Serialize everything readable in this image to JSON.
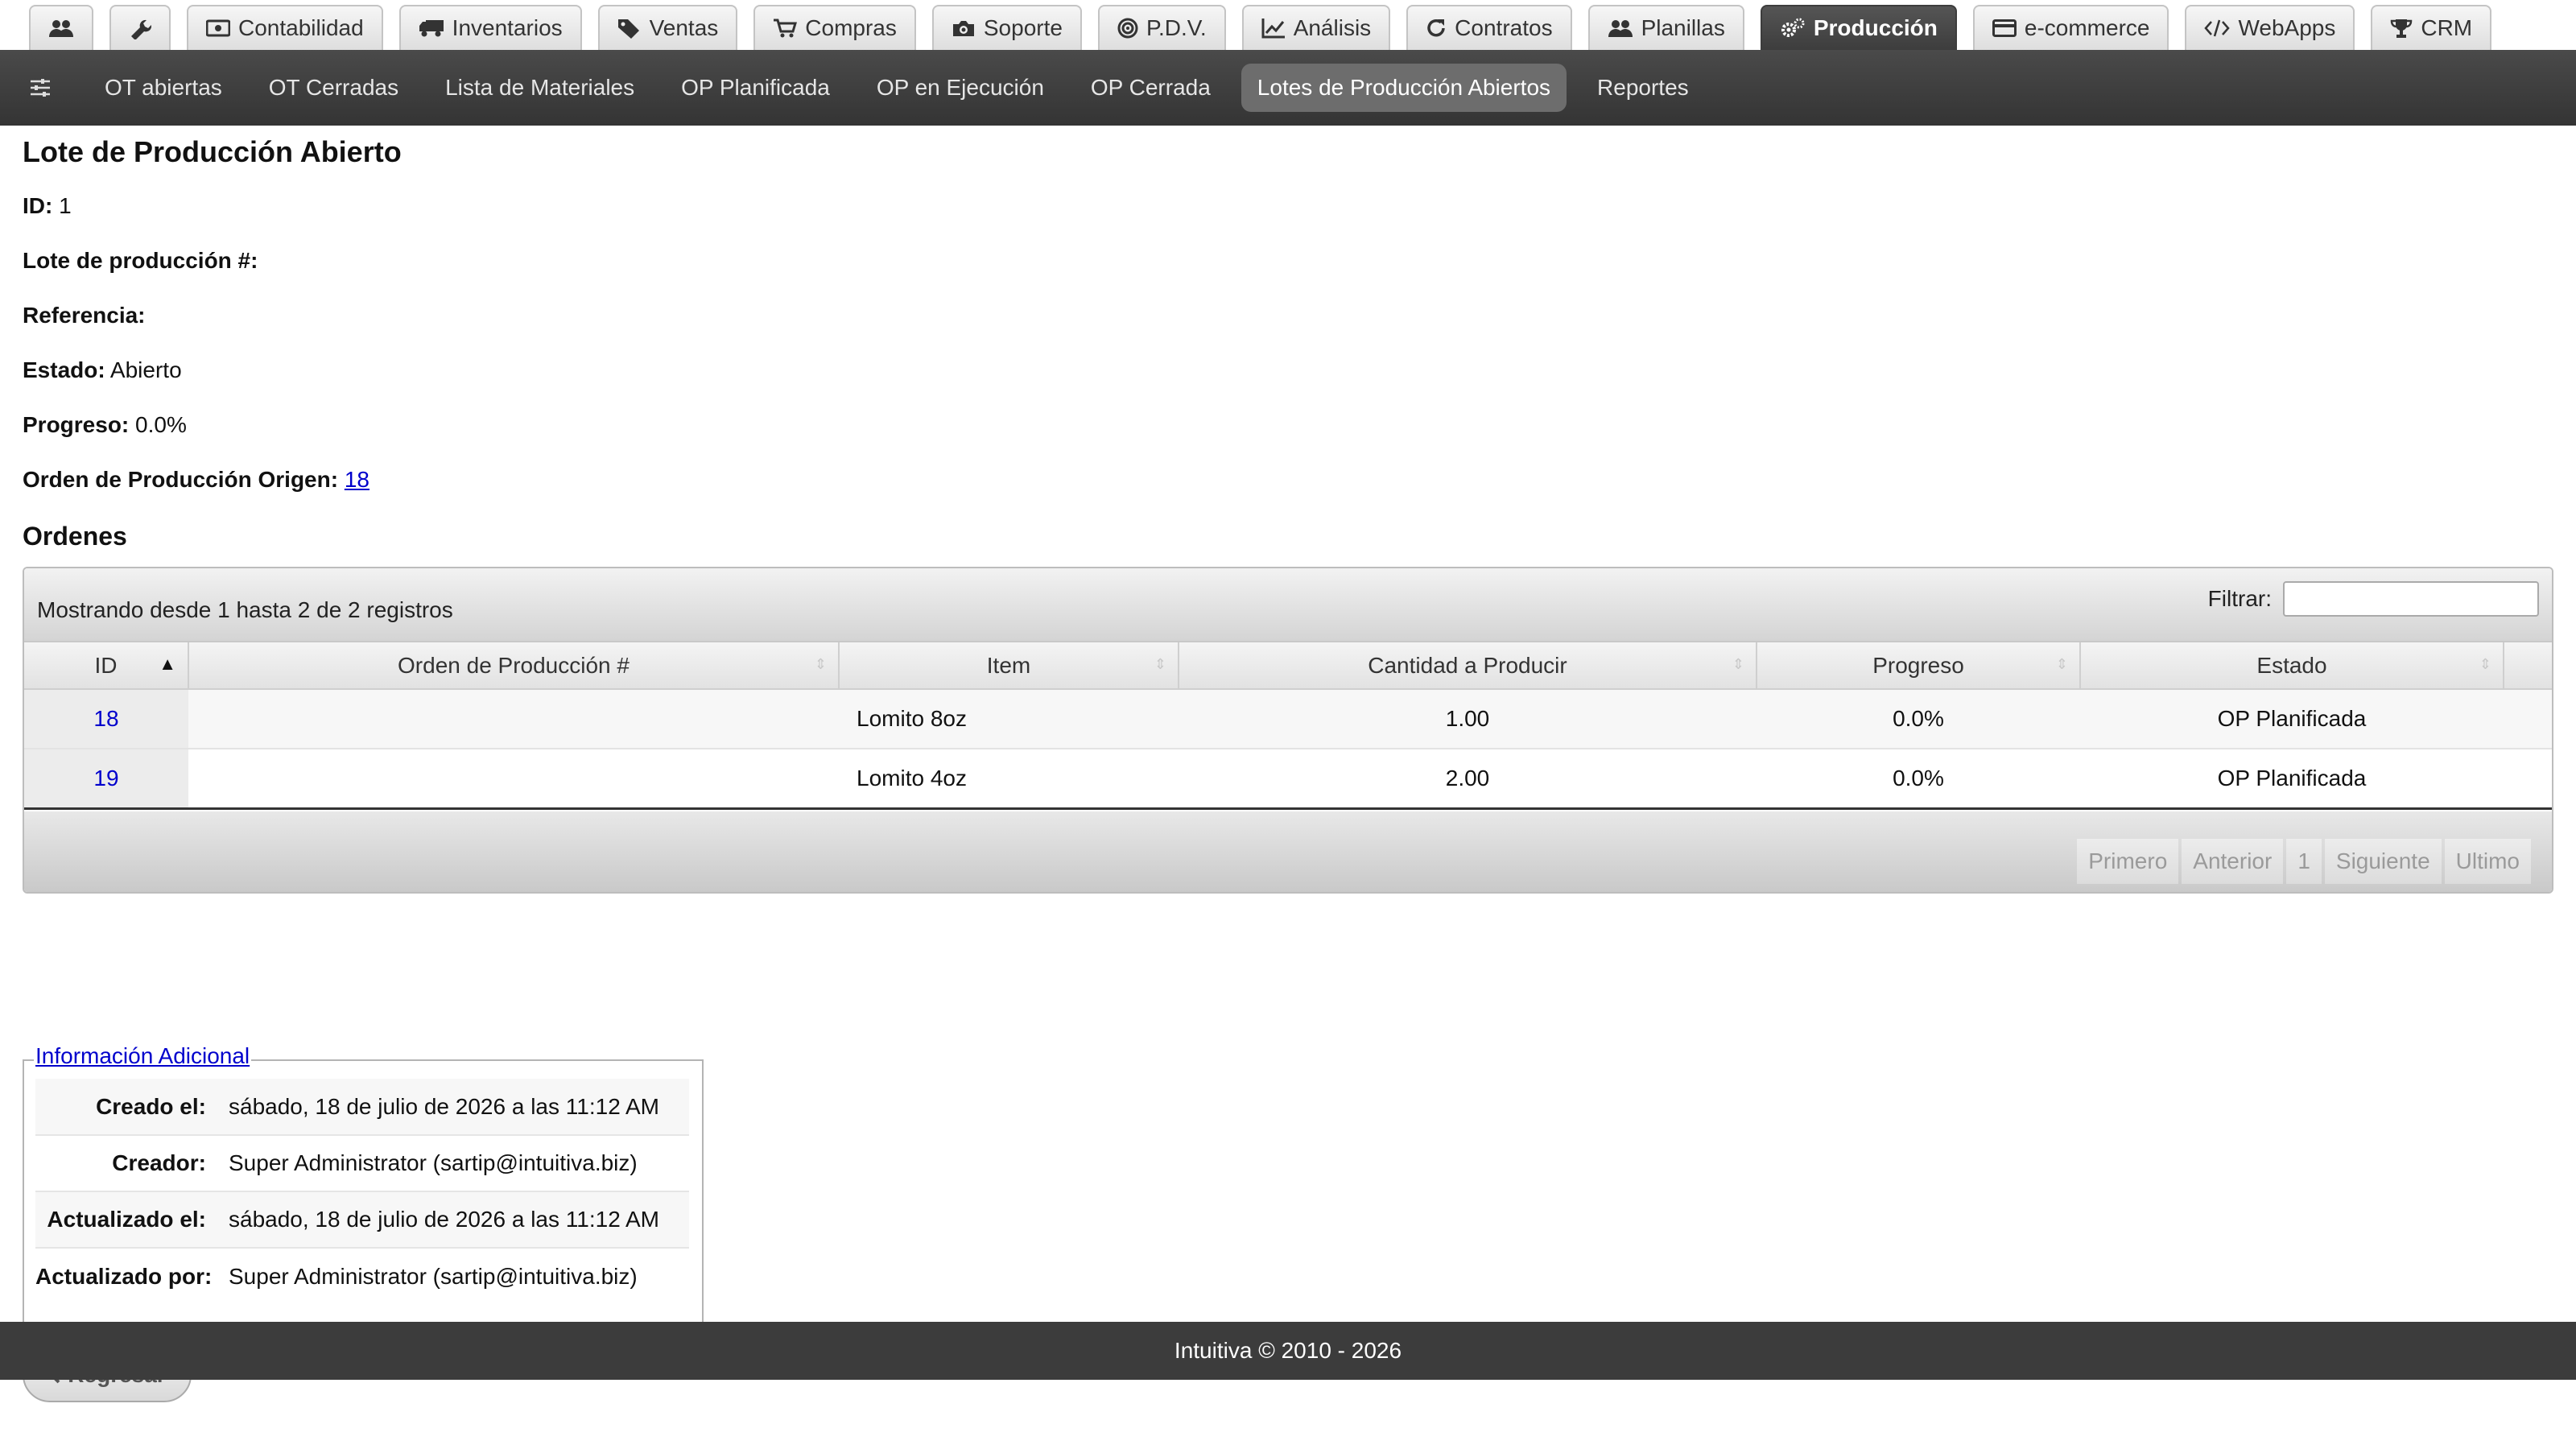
{
  "top_tabs": [
    {
      "label": "",
      "icon": "users-icon"
    },
    {
      "label": "",
      "icon": "wrench-icon"
    },
    {
      "label": "Contabilidad",
      "icon": "money-icon"
    },
    {
      "label": "Inventarios",
      "icon": "truck-icon"
    },
    {
      "label": "Ventas",
      "icon": "tag-icon"
    },
    {
      "label": "Compras",
      "icon": "cart-icon"
    },
    {
      "label": "Soporte",
      "icon": "camera-icon"
    },
    {
      "label": "P.D.V.",
      "icon": "target-icon"
    },
    {
      "label": "Análisis",
      "icon": "chart-icon"
    },
    {
      "label": "Contratos",
      "icon": "refresh-icon"
    },
    {
      "label": "Planillas",
      "icon": "users-icon"
    },
    {
      "label": "Producción",
      "icon": "gears-icon",
      "active": true
    },
    {
      "label": "e-commerce",
      "icon": "credit-card-icon"
    },
    {
      "label": "WebApps",
      "icon": "code-icon"
    },
    {
      "label": "CRM",
      "icon": "trophy-icon"
    }
  ],
  "subnav": {
    "items": [
      "OT abiertas",
      "OT Cerradas",
      "Lista de Materiales",
      "OP Planificada",
      "OP en Ejecución",
      "OP Cerrada",
      "Lotes de Producción Abiertos",
      "Reportes"
    ],
    "active_index": 6
  },
  "page": {
    "title": "Lote de Producción Abierto",
    "fields": {
      "id_label": "ID:",
      "id_value": "1",
      "lote_label": "Lote de producción #:",
      "lote_value": "",
      "ref_label": "Referencia:",
      "ref_value": "",
      "estado_label": "Estado:",
      "estado_value": "Abierto",
      "progreso_label": "Progreso:",
      "progreso_value": "0.0%",
      "origen_label": "Orden de Producción Origen:",
      "origen_value": "18"
    },
    "ordenes_title": "Ordenes"
  },
  "table": {
    "info": "Mostrando desde 1 hasta 2 de 2 registros",
    "filter_label": "Filtrar:",
    "filter_value": "",
    "columns": [
      "ID",
      "Orden de Producción #",
      "Item",
      "Cantidad a Producir",
      "Progreso",
      "Estado"
    ],
    "rows": [
      {
        "id": "18",
        "orden": "",
        "item": "Lomito 8oz",
        "cantidad": "1.00",
        "progreso": "0.0%",
        "estado": "OP Planificada"
      },
      {
        "id": "19",
        "orden": "",
        "item": "Lomito 4oz",
        "cantidad": "2.00",
        "progreso": "0.0%",
        "estado": "OP Planificada"
      }
    ],
    "pager": {
      "first": "Primero",
      "prev": "Anterior",
      "page": "1",
      "next": "Siguiente",
      "last": "Ultimo"
    }
  },
  "extra": {
    "legend": "Información Adicional",
    "rows": [
      {
        "k": "Creado el:",
        "v": "sábado, 18 de julio de 2026 a las 11:12 AM"
      },
      {
        "k": "Creador:",
        "v": "Super Administrator (sartip@intuitiva.biz)"
      },
      {
        "k": "Actualizado el:",
        "v": "sábado, 18 de julio de 2026 a las 11:12 AM"
      },
      {
        "k": "Actualizado por:",
        "v": "Super Administrator (sartip@intuitiva.biz)"
      }
    ]
  },
  "back_label": "Regresar",
  "footer": "Intuitiva © 2010 - 2026",
  "colors": {
    "active_tab": "#3d3d3d",
    "subnav_bg": "#3a3a3a",
    "link": "#0000cc",
    "footer_bg": "#3c3c3c"
  }
}
